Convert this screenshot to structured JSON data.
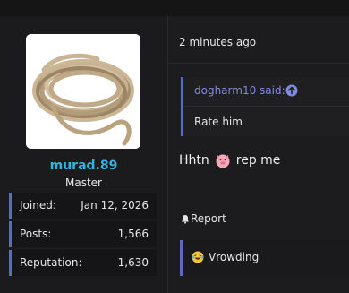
{
  "user": {
    "username": "murad.89",
    "title": "Master",
    "stats": [
      {
        "label": "Joined:",
        "value": "Jan 12, 2026"
      },
      {
        "label": "Posts:",
        "value": "1,566"
      },
      {
        "label": "Reputation:",
        "value": "1,630"
      }
    ]
  },
  "post": {
    "time": "2 minutes ago",
    "quote": {
      "author": "dogharm10 said:",
      "body": "Rate him"
    },
    "message_before": "Hhtn",
    "message_after": "rep me",
    "report_label": "Report",
    "reaction_label": "Vrowding"
  },
  "colors": {
    "username": "#30b5e0",
    "accent": "#5c6bc0",
    "quote_author": "#7f8bdc"
  },
  "icons": {
    "avatar": "rope-coil-image",
    "quote_jump": "arrow-up-circle-icon",
    "message_emoji": "pig-face-icon",
    "report": "bell-icon",
    "reaction": "laughing-tears-emoji-icon"
  }
}
